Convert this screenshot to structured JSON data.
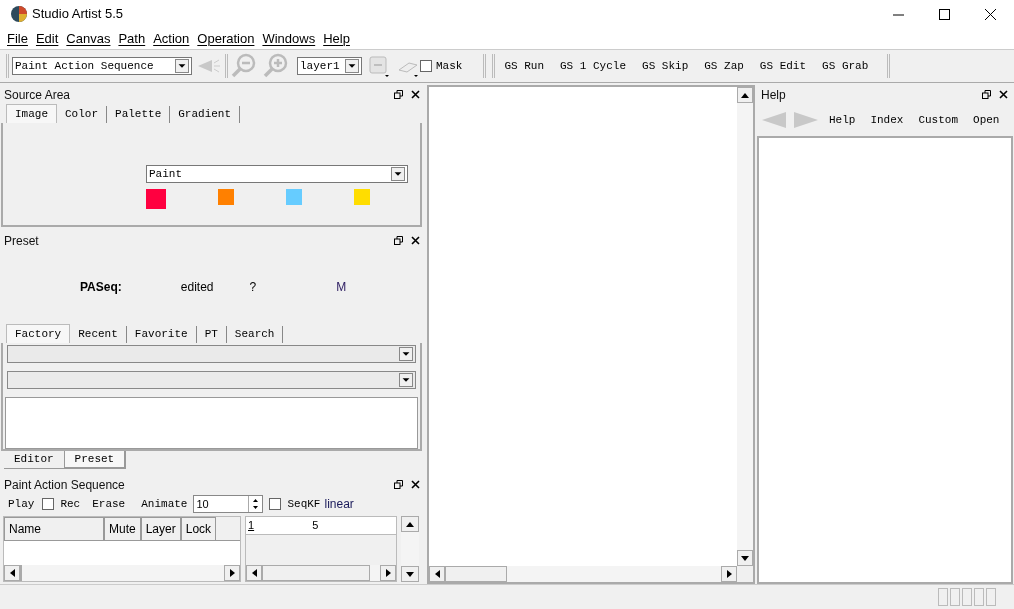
{
  "window": {
    "title": "Studio Artist 5.5"
  },
  "menu": [
    "File",
    "Edit",
    "Canvas",
    "Path",
    "Action",
    "Operation",
    "Windows",
    "Help"
  ],
  "toolbar": {
    "mode_select": "Paint Action Sequence",
    "layer_select": "layer1",
    "mask": {
      "label": "Mask",
      "checked": false
    },
    "gs_buttons": [
      "GS Run",
      "GS 1 Cycle",
      "GS Skip",
      "GS Zap",
      "GS Edit",
      "GS Grab"
    ]
  },
  "source_area": {
    "title": "Source Area",
    "tabs": [
      {
        "label": "Image",
        "selected": true
      },
      {
        "label": "Color",
        "selected": false
      },
      {
        "label": "Palette",
        "selected": false
      },
      {
        "label": "Gradient",
        "selected": false
      }
    ],
    "paint_select": "Paint",
    "swatches": [
      {
        "color": "#ff0040"
      },
      {
        "color": "#ff8000"
      },
      {
        "color": "#66ccff"
      },
      {
        "color": "#ffdd00"
      }
    ]
  },
  "preset": {
    "title": "Preset",
    "label": "PASeq:",
    "status": "edited",
    "question": "?",
    "flag": "M",
    "tabs": [
      {
        "label": "Factory",
        "selected": true
      },
      {
        "label": "Recent",
        "selected": false
      },
      {
        "label": "Favorite",
        "selected": false
      },
      {
        "label": "PT",
        "selected": false
      },
      {
        "label": "Search",
        "selected": false
      }
    ]
  },
  "panel_tabs": [
    {
      "label": "Editor",
      "selected": false
    },
    {
      "label": "Preset",
      "selected": true
    }
  ],
  "sequence": {
    "title": "Paint Action Sequence",
    "play": "Play",
    "rec": {
      "label": "Rec",
      "checked": false
    },
    "erase": "Erase",
    "animate": "Animate",
    "animate_value": "10",
    "seqkf": {
      "label": "SeqKF",
      "checked": false
    },
    "interp": "linear",
    "columns": [
      "Name",
      "Mute",
      "Layer",
      "Lock"
    ],
    "timeline": [
      "1",
      "5"
    ]
  },
  "help": {
    "title": "Help",
    "links": [
      "Help",
      "Index",
      "Custom",
      "Open"
    ]
  }
}
